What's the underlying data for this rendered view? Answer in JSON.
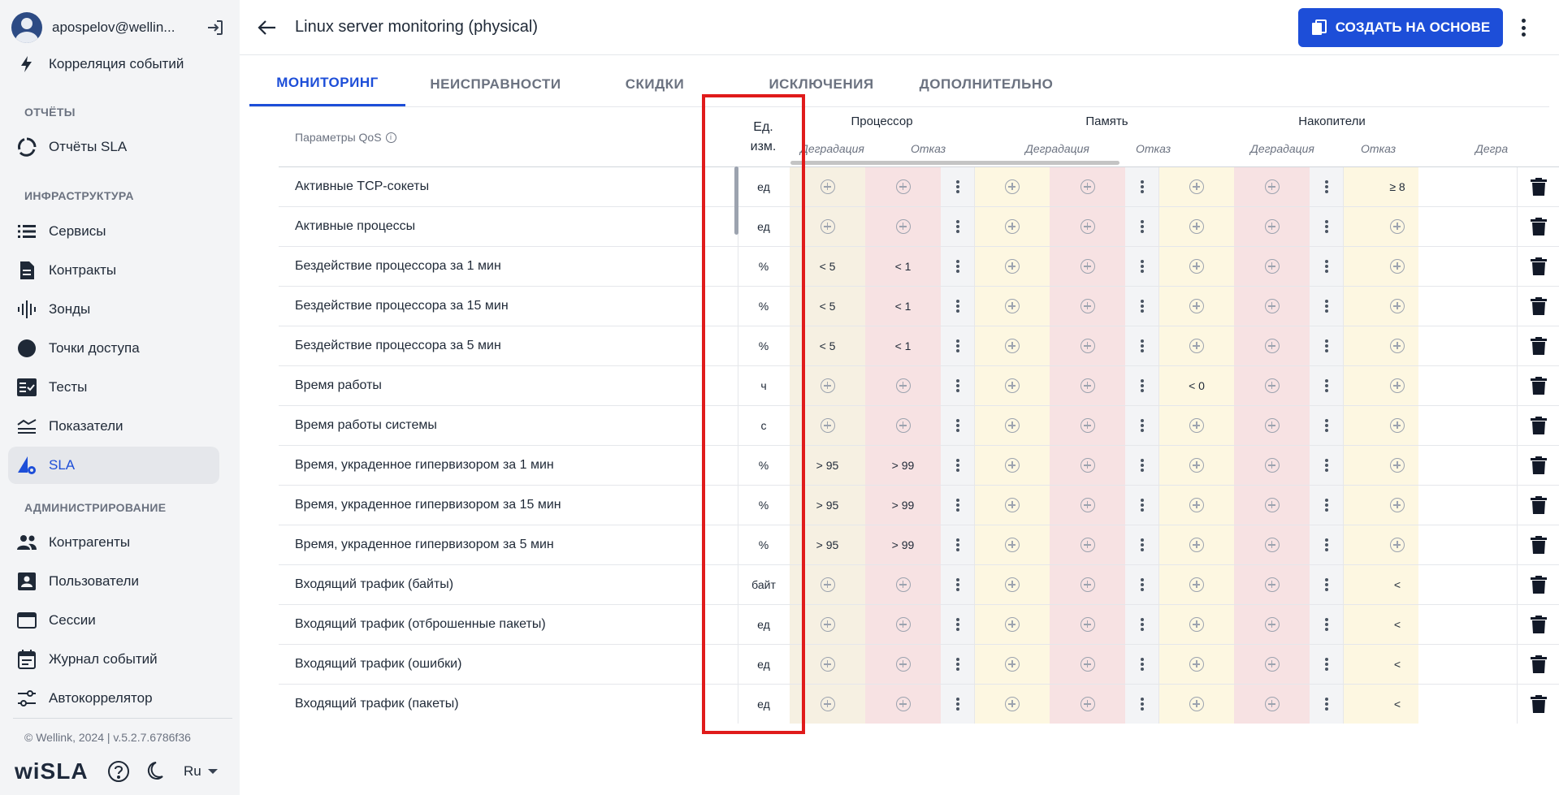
{
  "user": {
    "name": "apospelov@wellin..."
  },
  "sidebar": {
    "top_item": {
      "label": "Корреляция событий",
      "icon": "bolt-icon"
    },
    "sections": [
      {
        "title": "ОТЧЁТЫ",
        "items": [
          {
            "label": "Отчёты SLA",
            "icon": "sla-report-icon"
          }
        ]
      },
      {
        "title": "ИНФРАСТРУКТУРА",
        "items": [
          {
            "label": "Сервисы",
            "icon": "list-icon"
          },
          {
            "label": "Контракты",
            "icon": "document-icon"
          },
          {
            "label": "Зонды",
            "icon": "waveform-icon"
          },
          {
            "label": "Точки доступа",
            "icon": "circle-icon"
          },
          {
            "label": "Тесты",
            "icon": "checklist-icon"
          },
          {
            "label": "Показатели",
            "icon": "metrics-icon"
          },
          {
            "label": "SLA",
            "icon": "sla-gear-icon",
            "active": true
          }
        ]
      },
      {
        "title": "АДМИНИСТРИРОВАНИЕ",
        "items": [
          {
            "label": "Контрагенты",
            "icon": "people-icon"
          },
          {
            "label": "Пользователи",
            "icon": "user-card-icon"
          },
          {
            "label": "Сессии",
            "icon": "window-icon"
          },
          {
            "label": "Журнал событий",
            "icon": "calendar-icon"
          },
          {
            "label": "Автокоррелятор",
            "icon": "sliders-icon"
          }
        ]
      }
    ],
    "footer": "© Wellink, 2024 | v.5.2.7.6786f36",
    "brand": "wiSLA",
    "language": "Ru"
  },
  "header": {
    "title": "Linux server monitoring (physical)",
    "create_button": "СОЗДАТЬ НА ОСНОВЕ"
  },
  "tabs": [
    "МОНИТОРИНГ",
    "НЕИСПРАВНОСТИ",
    "СКИДКИ",
    "ИСКЛЮЧЕНИЯ",
    "ДОПОЛНИТЕЛЬНО"
  ],
  "active_tab": "МОНИТОРИНГ",
  "table": {
    "param_header": "Параметры QoS",
    "unit_header_line1": "Ед.",
    "unit_header_line2": "изм.",
    "groups": [
      "Процессор",
      "Память",
      "Накопители"
    ],
    "subheaders": {
      "degradation": "Деградация",
      "failure": "Отказ",
      "partial": "Дегра"
    },
    "rows": [
      {
        "name": "Активные TCP-сокеты",
        "unit": "ед",
        "cpu_d": "",
        "cpu_f": "",
        "mem_d": "",
        "mem_f": "",
        "disk_d": "",
        "disk_f": "",
        "extra": "≥ 8"
      },
      {
        "name": "Активные процессы",
        "unit": "ед",
        "cpu_d": "",
        "cpu_f": "",
        "mem_d": "",
        "mem_f": "",
        "disk_d": "",
        "disk_f": "",
        "extra": ""
      },
      {
        "name": "Бездействие процессора за 1 мин",
        "unit": "%",
        "cpu_d": "< 5",
        "cpu_f": "< 1",
        "mem_d": "",
        "mem_f": "",
        "disk_d": "",
        "disk_f": "",
        "extra": ""
      },
      {
        "name": "Бездействие процессора за 15 мин",
        "unit": "%",
        "cpu_d": "< 5",
        "cpu_f": "< 1",
        "mem_d": "",
        "mem_f": "",
        "disk_d": "",
        "disk_f": "",
        "extra": ""
      },
      {
        "name": "Бездействие процессора за 5 мин",
        "unit": "%",
        "cpu_d": "< 5",
        "cpu_f": "< 1",
        "mem_d": "",
        "mem_f": "",
        "disk_d": "",
        "disk_f": "",
        "extra": ""
      },
      {
        "name": "Время работы",
        "unit": "ч",
        "cpu_d": "",
        "cpu_f": "",
        "mem_d": "",
        "mem_f": "",
        "disk_d": "< 0",
        "disk_f": "",
        "extra": ""
      },
      {
        "name": "Время работы системы",
        "unit": "с",
        "cpu_d": "",
        "cpu_f": "",
        "mem_d": "",
        "mem_f": "",
        "disk_d": "",
        "disk_f": "",
        "extra": ""
      },
      {
        "name": "Время, украденное гипервизором за 1 мин",
        "unit": "%",
        "cpu_d": "> 95",
        "cpu_f": "> 99",
        "mem_d": "",
        "mem_f": "",
        "disk_d": "",
        "disk_f": "",
        "extra": ""
      },
      {
        "name": "Время, украденное гипервизором за 15 мин",
        "unit": "%",
        "cpu_d": "> 95",
        "cpu_f": "> 99",
        "mem_d": "",
        "mem_f": "",
        "disk_d": "",
        "disk_f": "",
        "extra": ""
      },
      {
        "name": "Время, украденное гипервизором за 5 мин",
        "unit": "%",
        "cpu_d": "> 95",
        "cpu_f": "> 99",
        "mem_d": "",
        "mem_f": "",
        "disk_d": "",
        "disk_f": "",
        "extra": ""
      },
      {
        "name": "Входящий трафик (байты)",
        "unit": "байт",
        "cpu_d": "",
        "cpu_f": "",
        "mem_d": "",
        "mem_f": "",
        "disk_d": "",
        "disk_f": "",
        "extra": "<"
      },
      {
        "name": "Входящий трафик (отброшенные пакеты)",
        "unit": "ед",
        "cpu_d": "",
        "cpu_f": "",
        "mem_d": "",
        "mem_f": "",
        "disk_d": "",
        "disk_f": "",
        "extra": "<"
      },
      {
        "name": "Входящий трафик (ошибки)",
        "unit": "ед",
        "cpu_d": "",
        "cpu_f": "",
        "mem_d": "",
        "mem_f": "",
        "disk_d": "",
        "disk_f": "",
        "extra": "<"
      },
      {
        "name": "Входящий трафик (пакеты)",
        "unit": "ед",
        "cpu_d": "",
        "cpu_f": "",
        "mem_d": "",
        "mem_f": "",
        "disk_d": "",
        "disk_f": "",
        "extra": "<"
      }
    ]
  },
  "colors": {
    "accent": "#1d4ed8",
    "degradation": "#fdf7e1",
    "failure": "#f7e2e3",
    "highlight": "#e01b1b"
  }
}
